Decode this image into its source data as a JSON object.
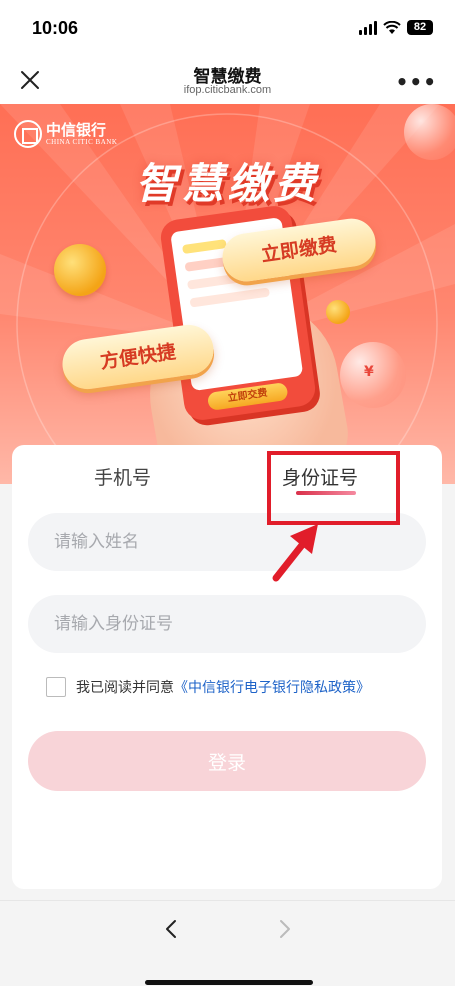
{
  "status_bar": {
    "time": "10:06",
    "battery": "82"
  },
  "nav": {
    "title": "智慧缴费",
    "url": "ifop.citicbank.com"
  },
  "banner": {
    "brand_name": "中信银行",
    "brand_en": "CHINA CITIC BANK",
    "headline": "智慧缴费",
    "pay_now": "立即缴费",
    "convenient": "方便快捷",
    "phone_button": "立即交费",
    "yen": "¥"
  },
  "form": {
    "tabs": [
      {
        "label": "手机号",
        "active": false
      },
      {
        "label": "身份证号",
        "active": true
      }
    ],
    "name_placeholder": "请输入姓名",
    "id_placeholder": "请输入身份证号",
    "agree_text": "我已阅读并同意",
    "agree_link": "《中信银行电子银行隐私政策》",
    "login_label": "登录"
  },
  "colors": {
    "accent": "#e11d2a",
    "banner_top": "#ff6f55",
    "link": "#1e63c8",
    "login_disabled": "#f8d4d8"
  }
}
